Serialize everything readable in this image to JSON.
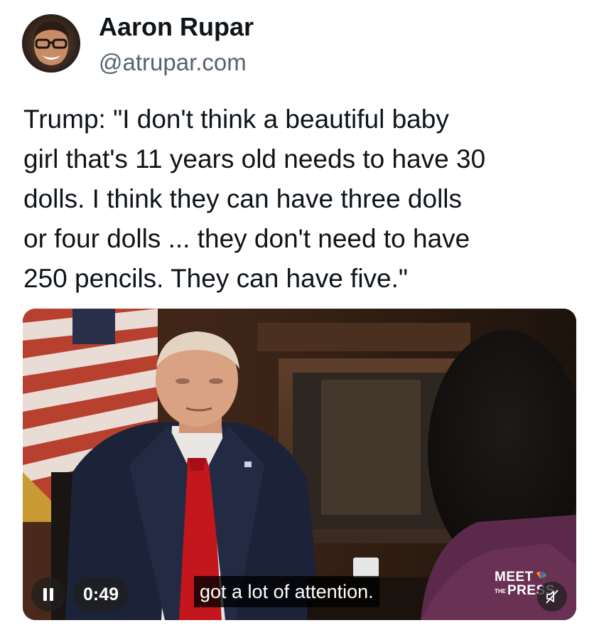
{
  "author": {
    "display_name": "Aaron Rupar",
    "handle": "@atrupar.com",
    "avatar_icon": "profile-photo"
  },
  "post": {
    "text": "Trump: \"I don't think a beautiful baby\ngirl that's 11 years old needs to have 30\ndolls. I think they can have three dolls\nor four dolls ... they don't need to have\n250 pencils. They can have five.\""
  },
  "video": {
    "time": "0:49",
    "caption": "got a lot of attention.",
    "logo": {
      "meet": "MEET",
      "the": "THE",
      "press": "PRESS"
    },
    "pause_icon": "pause-icon",
    "mute_icon": "speaker-muted-icon"
  },
  "colors": {
    "text": "#0f1419",
    "secondary_text": "#566370",
    "overlay": "#1e1e1e"
  }
}
